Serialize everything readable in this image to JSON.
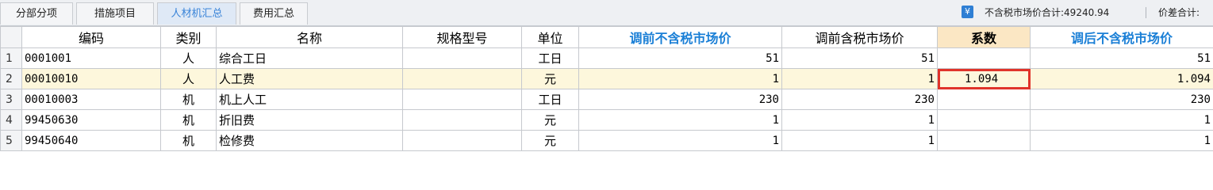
{
  "tabs": [
    "分部分项",
    "措施项目",
    "人材机汇总",
    "费用汇总"
  ],
  "active_tab": 2,
  "summary": {
    "currency_icon": "yen-icon",
    "market_total_label": "不含税市场价合计:49240.94",
    "diff_total_label": "价差合计:"
  },
  "columns": [
    "编码",
    "类别",
    "名称",
    "规格型号",
    "单位",
    "调前不含税市场价",
    "调前含税市场价",
    "系数",
    "调后不含税市场价"
  ],
  "rows": [
    {
      "no": "1",
      "code": "0001001",
      "type": "人",
      "name": "综合工日",
      "spec": "",
      "unit": "工日",
      "pre_ex": "51",
      "pre_in": "51",
      "coef": "",
      "post_ex": "51"
    },
    {
      "no": "2",
      "code": "00010010",
      "type": "人",
      "name": "人工费",
      "spec": "",
      "unit": "元",
      "pre_ex": "1",
      "pre_in": "1",
      "coef": "1.094",
      "post_ex": "1.094"
    },
    {
      "no": "3",
      "code": "00010003",
      "type": "机",
      "name": "机上人工",
      "spec": "",
      "unit": "工日",
      "pre_ex": "230",
      "pre_in": "230",
      "coef": "",
      "post_ex": "230"
    },
    {
      "no": "4",
      "code": "99450630",
      "type": "机",
      "name": "折旧费",
      "spec": "",
      "unit": "元",
      "pre_ex": "1",
      "pre_in": "1",
      "coef": "",
      "post_ex": "1"
    },
    {
      "no": "5",
      "code": "99450640",
      "type": "机",
      "name": "检修费",
      "spec": "",
      "unit": "元",
      "pre_ex": "1",
      "pre_in": "1",
      "coef": "",
      "post_ex": "1"
    }
  ],
  "selected_row": 1,
  "colors": {
    "accent_blue": "#1a7fd6",
    "highlight_red": "#e0332a",
    "selected_row_bg": "#fdf7dc",
    "coef_header_bg": "#fbe7c4"
  }
}
